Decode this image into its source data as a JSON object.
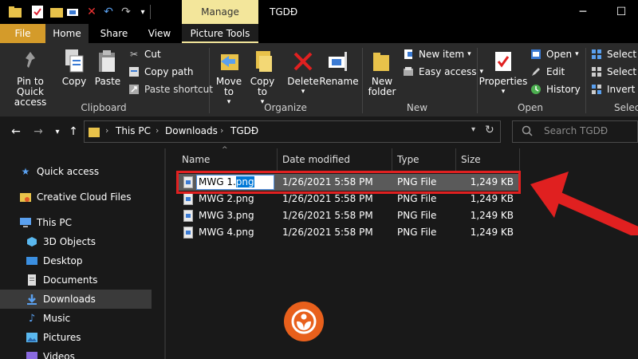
{
  "quick_access": {
    "icons": [
      "properties-icon",
      "new-folder-icon",
      "undo-icon",
      "redo-icon"
    ]
  },
  "title_bar": {
    "manage_tab": "Manage",
    "window_title": "TGDĐ"
  },
  "ribbon_tabs": {
    "file": "File",
    "home": "Home",
    "share": "Share",
    "view": "View",
    "picture_tools": "Picture Tools"
  },
  "ribbon": {
    "clipboard": {
      "pin": "Pin to Quick access",
      "copy": "Copy",
      "paste": "Paste",
      "cut": "Cut",
      "copy_path": "Copy path",
      "paste_shortcut": "Paste shortcut",
      "group": "Clipboard"
    },
    "organize": {
      "move_to": "Move to",
      "copy_to": "Copy to",
      "delete": "Delete",
      "rename": "Rename",
      "group": "Organize"
    },
    "new": {
      "new_folder": "New folder",
      "new_item": "New item",
      "easy_access": "Easy access",
      "group": "New"
    },
    "open": {
      "properties": "Properties",
      "open": "Open",
      "edit": "Edit",
      "history": "History",
      "group": "Open"
    },
    "select": {
      "select_all": "Select all",
      "select_none": "Select none",
      "invert": "Invert selection",
      "group": "Select"
    }
  },
  "address": {
    "crumbs": [
      "This PC",
      "Downloads",
      "TGDĐ"
    ],
    "search_placeholder": "Search TGDĐ"
  },
  "sidebar": {
    "items": [
      {
        "label": "Quick access",
        "icon": "star-icon"
      },
      {
        "label": "Creative Cloud Files",
        "icon": "cloud-folder-icon"
      },
      {
        "label": "This PC",
        "icon": "pc-icon"
      },
      {
        "label": "3D Objects",
        "icon": "cube-icon"
      },
      {
        "label": "Desktop",
        "icon": "desktop-icon"
      },
      {
        "label": "Documents",
        "icon": "documents-icon"
      },
      {
        "label": "Downloads",
        "icon": "download-icon"
      },
      {
        "label": "Music",
        "icon": "music-icon"
      },
      {
        "label": "Pictures",
        "icon": "pictures-icon"
      },
      {
        "label": "Videos",
        "icon": "videos-icon"
      }
    ]
  },
  "columns": {
    "name": "Name",
    "date": "Date modified",
    "type": "Type",
    "size": "Size"
  },
  "files": [
    {
      "name": "MWG 1.png",
      "date": "1/26/2021 5:58 PM",
      "type": "PNG File",
      "size": "1,249 KB"
    },
    {
      "name": "MWG 2.png",
      "date": "1/26/2021 5:58 PM",
      "type": "PNG File",
      "size": "1,249 KB"
    },
    {
      "name": "MWG 3.png",
      "date": "1/26/2021 5:58 PM",
      "type": "PNG File",
      "size": "1,249 KB"
    },
    {
      "name": "MWG 4.png",
      "date": "1/26/2021 5:58 PM",
      "type": "PNG File",
      "size": "1,249 KB"
    }
  ],
  "rename": {
    "base": "MWG 1.",
    "selected_ext": "png"
  },
  "colors": {
    "file_tab": "#d49b2a",
    "manage_tab": "#f3e69b",
    "highlight_red": "#e02020",
    "selection_blue": "#0078d7",
    "logo_orange": "#e8601c"
  }
}
